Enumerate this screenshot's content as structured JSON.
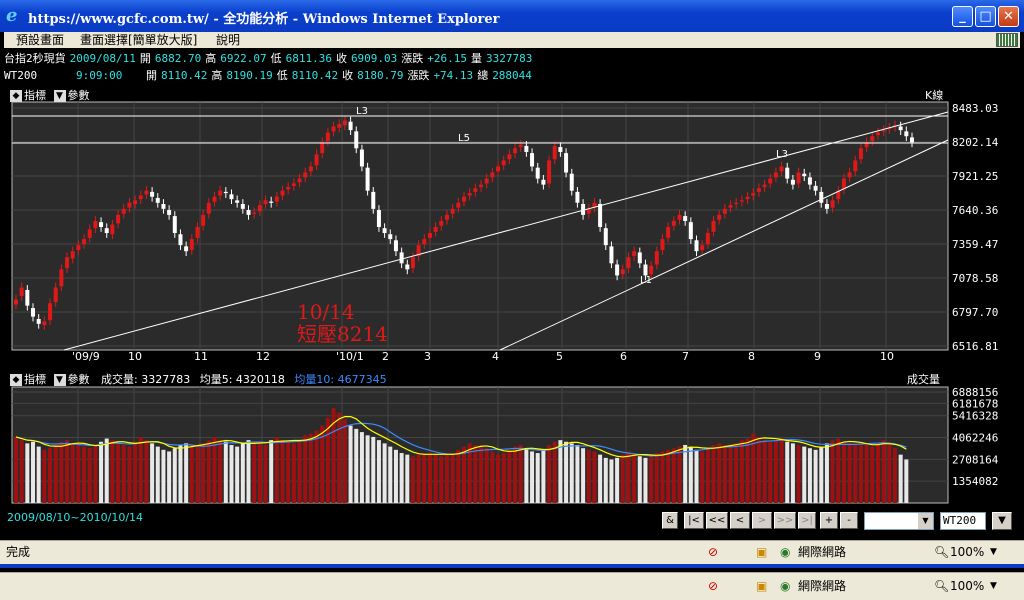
{
  "window": {
    "title": "https://www.gcfc.com.tw/ - 全功能分析 - Windows Internet Explorer"
  },
  "menu": {
    "items": [
      "預設畫面",
      "畫面選擇[簡單放大版]",
      "說明"
    ]
  },
  "quote1": {
    "name": "台指2秒現貨",
    "date": "2009/08/11",
    "open_label": "開",
    "open": "6882.70",
    "high_label": "高",
    "high": "6922.07",
    "low_label": "低",
    "low": "6811.36",
    "close_label": "收",
    "close": "6909.03",
    "chg_label": "漲跌",
    "chg": "+26.15",
    "vol_label": "量",
    "vol": "3327783"
  },
  "quote2": {
    "name": "WT200",
    "time": "9:09:00",
    "open_label": "開",
    "open": "8110.42",
    "high_label": "高",
    "high": "8190.19",
    "low_label": "低",
    "low": "8110.42",
    "close_label": "收",
    "close": "8180.79",
    "chg_label": "漲跌",
    "chg": "+74.13",
    "vol_label": "總",
    "vol": "288044"
  },
  "panel1": {
    "indicator": "指標",
    "param": "參數",
    "chart_name": "K線"
  },
  "panel2": {
    "indicator": "指標",
    "param": "參數",
    "vol_text": "成交量: 3327783",
    "ma5_text": "均量5: 4320118",
    "ma10_text": "均量10: 4677345",
    "chart_name": "成交量"
  },
  "annotation": {
    "line1": "10/14",
    "line2": "短壓8214"
  },
  "date_range": "2009/08/10~2010/10/14",
  "nav": {
    "amp": "&",
    "first": "|<",
    "prev_page": "<<",
    "prev": "<",
    "next": ">",
    "next_page": ">>",
    "last": ">|",
    "plus": "+",
    "minus": "-",
    "symbol": "WT200"
  },
  "status": {
    "text": "完成",
    "zone": "網際網路",
    "zoom": "100%"
  },
  "colors": {
    "up": "#e01818",
    "down": "#ffffff",
    "ma5": "#ffff00",
    "ma10": "#3a8cff",
    "grid": "#444444"
  },
  "chart_data": [
    {
      "type": "candlestick",
      "y_ticks": [
        "8483.03",
        "8202.14",
        "7921.25",
        "7640.36",
        "7359.47",
        "7078.58",
        "6797.70",
        "6516.81"
      ],
      "ylim": [
        6516.81,
        8483.03
      ],
      "x_ticks": [
        "'09/9",
        "10",
        "11",
        "12",
        "'10/1",
        "2",
        "3",
        "4",
        "5",
        "6",
        "7",
        "8",
        "9",
        "10"
      ],
      "line_labels": [
        "L3",
        "L5",
        "L3",
        "L1"
      ],
      "closes": [
        6900,
        7000,
        6850,
        6760,
        6700,
        6720,
        6870,
        7000,
        7150,
        7250,
        7300,
        7350,
        7400,
        7480,
        7550,
        7500,
        7450,
        7520,
        7600,
        7650,
        7700,
        7720,
        7760,
        7800,
        7750,
        7700,
        7650,
        7600,
        7450,
        7350,
        7300,
        7400,
        7500,
        7600,
        7700,
        7750,
        7800,
        7780,
        7730,
        7700,
        7650,
        7600,
        7620,
        7680,
        7720,
        7700,
        7750,
        7800,
        7830,
        7860,
        7900,
        7950,
        8000,
        8100,
        8200,
        8280,
        8330,
        8350,
        8380,
        8300,
        8150,
        8000,
        7800,
        7650,
        7500,
        7450,
        7400,
        7300,
        7200,
        7150,
        7250,
        7350,
        7400,
        7450,
        7500,
        7550,
        7600,
        7650,
        7700,
        7750,
        7780,
        7820,
        7850,
        7900,
        7950,
        8000,
        8050,
        8100,
        8150,
        8180,
        8120,
        8000,
        7900,
        7850,
        8050,
        8170,
        8120,
        7950,
        7800,
        7700,
        7600,
        7650,
        7700,
        7500,
        7350,
        7200,
        7100,
        7150,
        7250,
        7300,
        7200,
        7100,
        7180,
        7300,
        7400,
        7500,
        7550,
        7600,
        7550,
        7400,
        7300,
        7350,
        7450,
        7550,
        7600,
        7650,
        7680,
        7700,
        7720,
        7750,
        7780,
        7820,
        7850,
        7900,
        7950,
        8000,
        7900,
        7850,
        7950,
        7920,
        7850,
        7800,
        7700,
        7650,
        7720,
        7800,
        7900,
        7950,
        8050,
        8150,
        8200,
        8250,
        8280,
        8300,
        8320,
        8340,
        8300,
        8250,
        8200
      ],
      "opens": [
        6860,
        6930,
        6980,
        6830,
        6740,
        6690,
        6730,
        6880,
        7010,
        7160,
        7240,
        7310,
        7360,
        7410,
        7490,
        7540,
        7490,
        7440,
        7530,
        7610,
        7660,
        7690,
        7730,
        7770,
        7790,
        7740,
        7690,
        7640,
        7590,
        7440,
        7340,
        7310,
        7410,
        7510,
        7610,
        7710,
        7760,
        7790,
        7770,
        7720,
        7690,
        7640,
        7610,
        7630,
        7690,
        7710,
        7710,
        7760,
        7810,
        7840,
        7870,
        7910,
        7960,
        8010,
        8110,
        8210,
        8290,
        8320,
        8340,
        8370,
        8290,
        8140,
        7990,
        7790,
        7640,
        7490,
        7440,
        7390,
        7290,
        7190,
        7160,
        7260,
        7360,
        7410,
        7460,
        7510,
        7560,
        7610,
        7660,
        7710,
        7760,
        7790,
        7830,
        7860,
        7910,
        7960,
        8010,
        8060,
        8110,
        8160,
        8170,
        8110,
        7990,
        7890,
        7860,
        8060,
        8160,
        8110,
        7940,
        7790,
        7690,
        7610,
        7660,
        7690,
        7490,
        7340,
        7190,
        7110,
        7160,
        7260,
        7290,
        7190,
        7110,
        7190,
        7310,
        7410,
        7510,
        7560,
        7590,
        7540,
        7390,
        7310,
        7360,
        7460,
        7560,
        7610,
        7660,
        7690,
        7710,
        7730,
        7760,
        7790,
        7830,
        7860,
        7910,
        7960,
        7990,
        7890,
        7860,
        7940,
        7910,
        7840,
        7790,
        7690,
        7660,
        7730,
        7810,
        7910,
        7960,
        8060,
        8160,
        8210,
        8260,
        8290,
        8310,
        8330,
        8330,
        8290,
        8240
      ],
      "volume_ticks": [
        "6888156",
        "6181678",
        "5416328",
        "4062246",
        "2708164",
        "1354082"
      ],
      "volume_ylim": [
        0,
        6888156
      ],
      "volumes": [
        4100000,
        3900000,
        3700000,
        3800000,
        3500000,
        3300000,
        3400000,
        3600000,
        3800000,
        3900000,
        3700000,
        3600000,
        3500000,
        3400000,
        3600000,
        3800000,
        4000000,
        3900000,
        3700000,
        3600000,
        3500000,
        3800000,
        4100000,
        3900000,
        3700000,
        3500000,
        3300000,
        3200000,
        3400000,
        3600000,
        3700000,
        3600000,
        3500000,
        3700000,
        3900000,
        4100000,
        3900000,
        3800000,
        3600000,
        3500000,
        3700000,
        3900000,
        3800000,
        3700000,
        3600000,
        3900000,
        4100000,
        3900000,
        3800000,
        3700000,
        3900000,
        4200000,
        4300000,
        4500000,
        4800000,
        5300000,
        5900000,
        5600000,
        5200000,
        4800000,
        4600000,
        4400000,
        4200000,
        4100000,
        3900000,
        3700000,
        3500000,
        3300000,
        3100000,
        3000000,
        2900000,
        3000000,
        3100000,
        3100000,
        3000000,
        2900000,
        3000000,
        3100000,
        3300000,
        3500000,
        3700000,
        3600000,
        3500000,
        3400000,
        3200000,
        3000000,
        3100000,
        3300000,
        3500000,
        3600000,
        3400000,
        3200000,
        3100000,
        3300000,
        3600000,
        3800000,
        3900000,
        3800000,
        3700000,
        3600000,
        3400000,
        3300000,
        3200000,
        3000000,
        2800000,
        2700000,
        2800000,
        3000000,
        3200000,
        3100000,
        2900000,
        2800000,
        2900000,
        3100000,
        3200000,
        3300000,
        3400000,
        3500000,
        3600000,
        3500000,
        3300000,
        3200000,
        3400000,
        3600000,
        3700000,
        3600000,
        3500000,
        3700000,
        3900000,
        4000000,
        4300000,
        4100000,
        3900000,
        3800000,
        3900000,
        4000000,
        3800000,
        3700000,
        3600000,
        3500000,
        3400000,
        3300000,
        3500000,
        3700000,
        3900000,
        4000000,
        3800000,
        3700000,
        3600000,
        3700000,
        3600000,
        3500000,
        3700000,
        3900000,
        3700000,
        3400000,
        3000000,
        2700000
      ]
    }
  ]
}
